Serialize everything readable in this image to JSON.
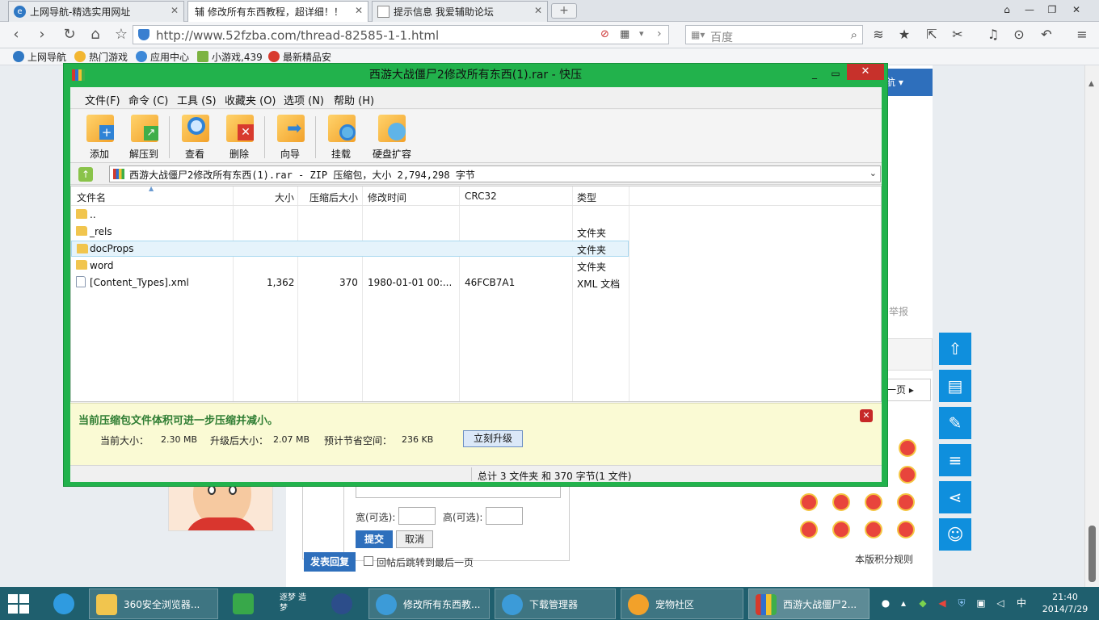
{
  "browser": {
    "tabs": [
      {
        "label": "上网导航-精选实用网址",
        "icon": "ie-icon"
      },
      {
        "label": "辅 修改所有东西教程，超详细！！",
        "icon": "site-icon"
      },
      {
        "label": "提示信息 我爱辅助论坛",
        "icon": "page-icon"
      }
    ],
    "url": "http://www.52fzba.com/thread-82585-1-1.html",
    "search_placeholder": "百度",
    "bookmarks": [
      "上网导航",
      "热门游戏",
      "应用中心",
      "小游戏,439",
      "最新精品安"
    ]
  },
  "webpage": {
    "nav_select": "航 ▾",
    "report": "举报",
    "next_page": "一页 ▸",
    "width_label": "宽(可选):",
    "height_label": "高(可选):",
    "submit": "提交",
    "cancel": "取消",
    "post_reply": "发表回复",
    "jump_back": "回帖后跳转到最后一页",
    "rules": "本版积分规则",
    "float_buttons": [
      "top-icon",
      "doc-icon",
      "edit-icon",
      "list-icon",
      "share-icon",
      "user-icon"
    ]
  },
  "kuaiya": {
    "title": "西游大战僵尸2修改所有东西(1).rar - 快压",
    "menu": [
      "文件(F)",
      "命令 (C)",
      "工具 (S)",
      "收藏夹 (O)",
      "选项 (N)",
      "帮助 (H)"
    ],
    "toolbar": [
      "添加",
      "解压到",
      "查看",
      "删除",
      "向导",
      "挂载",
      "硬盘扩容"
    ],
    "path": "西游大战僵尸2修改所有东西(1).rar - ZIP 压缩包，大小 2,794,298 字节",
    "columns": [
      "文件名",
      "大小",
      "压缩后大小",
      "修改时间",
      "CRC32",
      "类型"
    ],
    "files": [
      {
        "name": "..",
        "size": "",
        "packed": "",
        "modified": "",
        "crc": "",
        "type": ""
      },
      {
        "name": "_rels",
        "size": "",
        "packed": "",
        "modified": "",
        "crc": "",
        "type": "文件夹"
      },
      {
        "name": "docProps",
        "size": "",
        "packed": "",
        "modified": "",
        "crc": "",
        "type": "文件夹"
      },
      {
        "name": "word",
        "size": "",
        "packed": "",
        "modified": "",
        "crc": "",
        "type": "文件夹"
      },
      {
        "name": "[Content_Types].xml",
        "size": "1,362",
        "packed": "370",
        "modified": "1980-01-01 00:...",
        "crc": "46FCB7A1",
        "type": "XML 文档"
      }
    ],
    "upgrade": {
      "title": "当前压缩包文件体积可进一步压缩并减小。",
      "current_label": "当前大小：",
      "current_value": "2.30 MB",
      "after_label": "升级后大小：",
      "after_value": "2.07 MB",
      "save_label": "预计节省空间：",
      "save_value": "236 KB",
      "button": "立刻升级"
    },
    "status": "总计 3 文件夹 和 370 字节(1 文件)"
  },
  "taskbar": {
    "items": [
      "360安全浏览器...",
      "修改所有东西教...",
      "下载管理器",
      "宠物社区",
      "西游大战僵尸2..."
    ],
    "pinned_text": "逐梦 造梦",
    "time": "21:40",
    "date": "2014/7/29",
    "ime": "中"
  },
  "colors": {
    "window_border": "#22b24c",
    "accent_blue": "#0f8fdd",
    "taskbar": "#1f5f6e"
  }
}
